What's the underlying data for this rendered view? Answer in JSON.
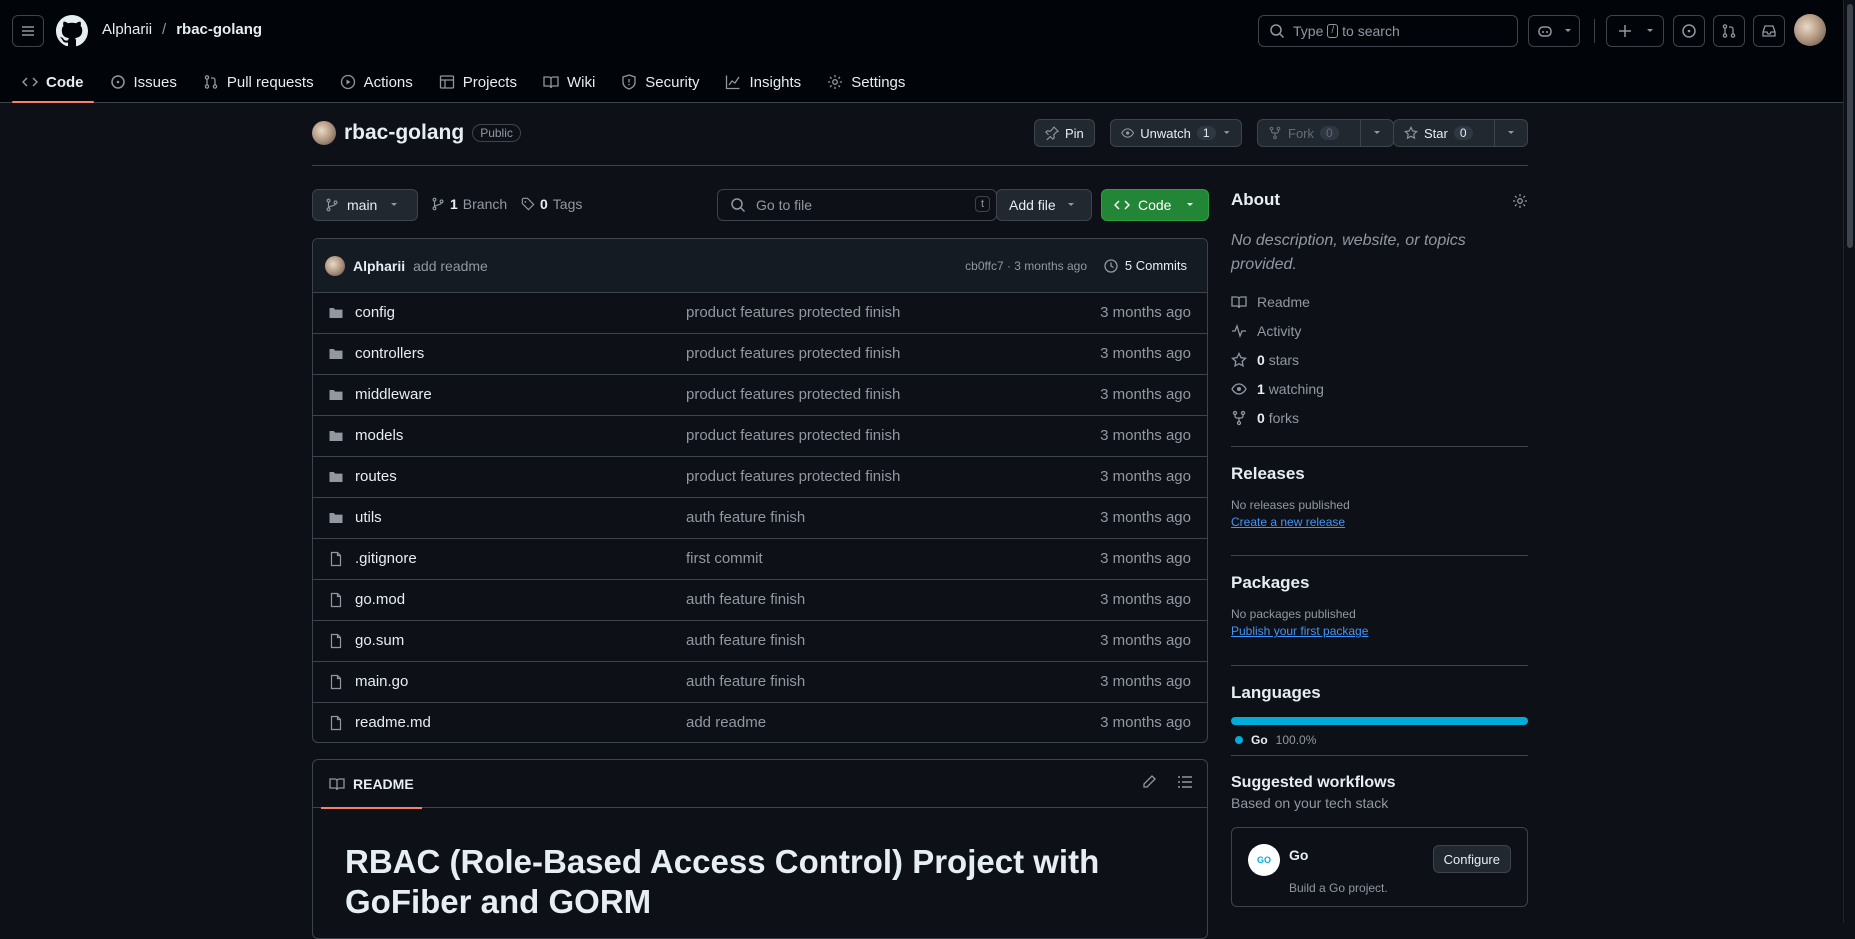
{
  "header": {
    "owner": "Alpharii",
    "separator": "/",
    "repo": "rbac-golang",
    "search_prefix": "Type",
    "search_key": "/",
    "search_suffix": "to search",
    "plus_label": "+"
  },
  "nav_tabs": [
    {
      "label": "Code",
      "icon": "code-icon"
    },
    {
      "label": "Issues",
      "icon": "issue-icon"
    },
    {
      "label": "Pull requests",
      "icon": "pull-request-icon"
    },
    {
      "label": "Actions",
      "icon": "play-icon"
    },
    {
      "label": "Projects",
      "icon": "table-icon"
    },
    {
      "label": "Wiki",
      "icon": "book-icon"
    },
    {
      "label": "Security",
      "icon": "shield-icon"
    },
    {
      "label": "Insights",
      "icon": "graph-icon"
    },
    {
      "label": "Settings",
      "icon": "gear-icon"
    }
  ],
  "repo_head": {
    "name": "rbac-golang",
    "visibility": "Public",
    "pin_label": "Pin",
    "unwatch_label": "Unwatch",
    "watch_count": "1",
    "fork_label": "Fork",
    "fork_count": "0",
    "star_label": "Star",
    "star_count": "0"
  },
  "toolbar": {
    "branch": "main",
    "branch_count": "1",
    "branch_label": "Branch",
    "tag_count": "0",
    "tag_label": "Tags",
    "goto_placeholder": "Go to file",
    "goto_key": "t",
    "add_file_label": "Add file",
    "code_label": "Code"
  },
  "commit": {
    "author": "Alpharii",
    "message": "add readme",
    "sha_time": "cb0ffc7 · 3 months ago",
    "commits_label": "5 Commits"
  },
  "files": [
    {
      "name": "config",
      "type": "folder",
      "message": "product features protected finish",
      "date": "3 months ago"
    },
    {
      "name": "controllers",
      "type": "folder",
      "message": "product features protected finish",
      "date": "3 months ago"
    },
    {
      "name": "middleware",
      "type": "folder",
      "message": "product features protected finish",
      "date": "3 months ago"
    },
    {
      "name": "models",
      "type": "folder",
      "message": "product features protected finish",
      "date": "3 months ago"
    },
    {
      "name": "routes",
      "type": "folder",
      "message": "product features protected finish",
      "date": "3 months ago"
    },
    {
      "name": "utils",
      "type": "folder",
      "message": "auth feature finish",
      "date": "3 months ago"
    },
    {
      "name": ".gitignore",
      "type": "file",
      "message": "first commit",
      "date": "3 months ago"
    },
    {
      "name": "go.mod",
      "type": "file",
      "message": "auth feature finish",
      "date": "3 months ago"
    },
    {
      "name": "go.sum",
      "type": "file",
      "message": "auth feature finish",
      "date": "3 months ago"
    },
    {
      "name": "main.go",
      "type": "file",
      "message": "auth feature finish",
      "date": "3 months ago"
    },
    {
      "name": "readme.md",
      "type": "file",
      "message": "add readme",
      "date": "3 months ago"
    }
  ],
  "readme": {
    "tab_label": "README",
    "heading": "RBAC (Role-Based Access Control) Project with GoFiber and GORM"
  },
  "about": {
    "title": "About",
    "description": "No description, website, or topics provided.",
    "readme_label": "Readme",
    "activity_label": "Activity",
    "stars_count": "0",
    "stars_label": "stars",
    "watching_count": "1",
    "watching_label": "watching",
    "forks_count": "0",
    "forks_label": "forks"
  },
  "releases": {
    "title": "Releases",
    "empty": "No releases published",
    "link": "Create a new release"
  },
  "packages": {
    "title": "Packages",
    "empty": "No packages published",
    "link": "Publish your first package"
  },
  "languages": {
    "title": "Languages",
    "items": [
      {
        "name": "Go",
        "percent": "100.0%",
        "color": "#00add8",
        "share": 1.0
      }
    ]
  },
  "workflows": {
    "title": "Suggested workflows",
    "subtitle": "Based on your tech stack",
    "item_name": "Go",
    "item_logo": "GO",
    "item_desc": "Build a Go project.",
    "configure_label": "Configure"
  },
  "colors": {
    "accent_tab": "#f78166",
    "code_button": "#238636",
    "link": "#4493f8"
  }
}
